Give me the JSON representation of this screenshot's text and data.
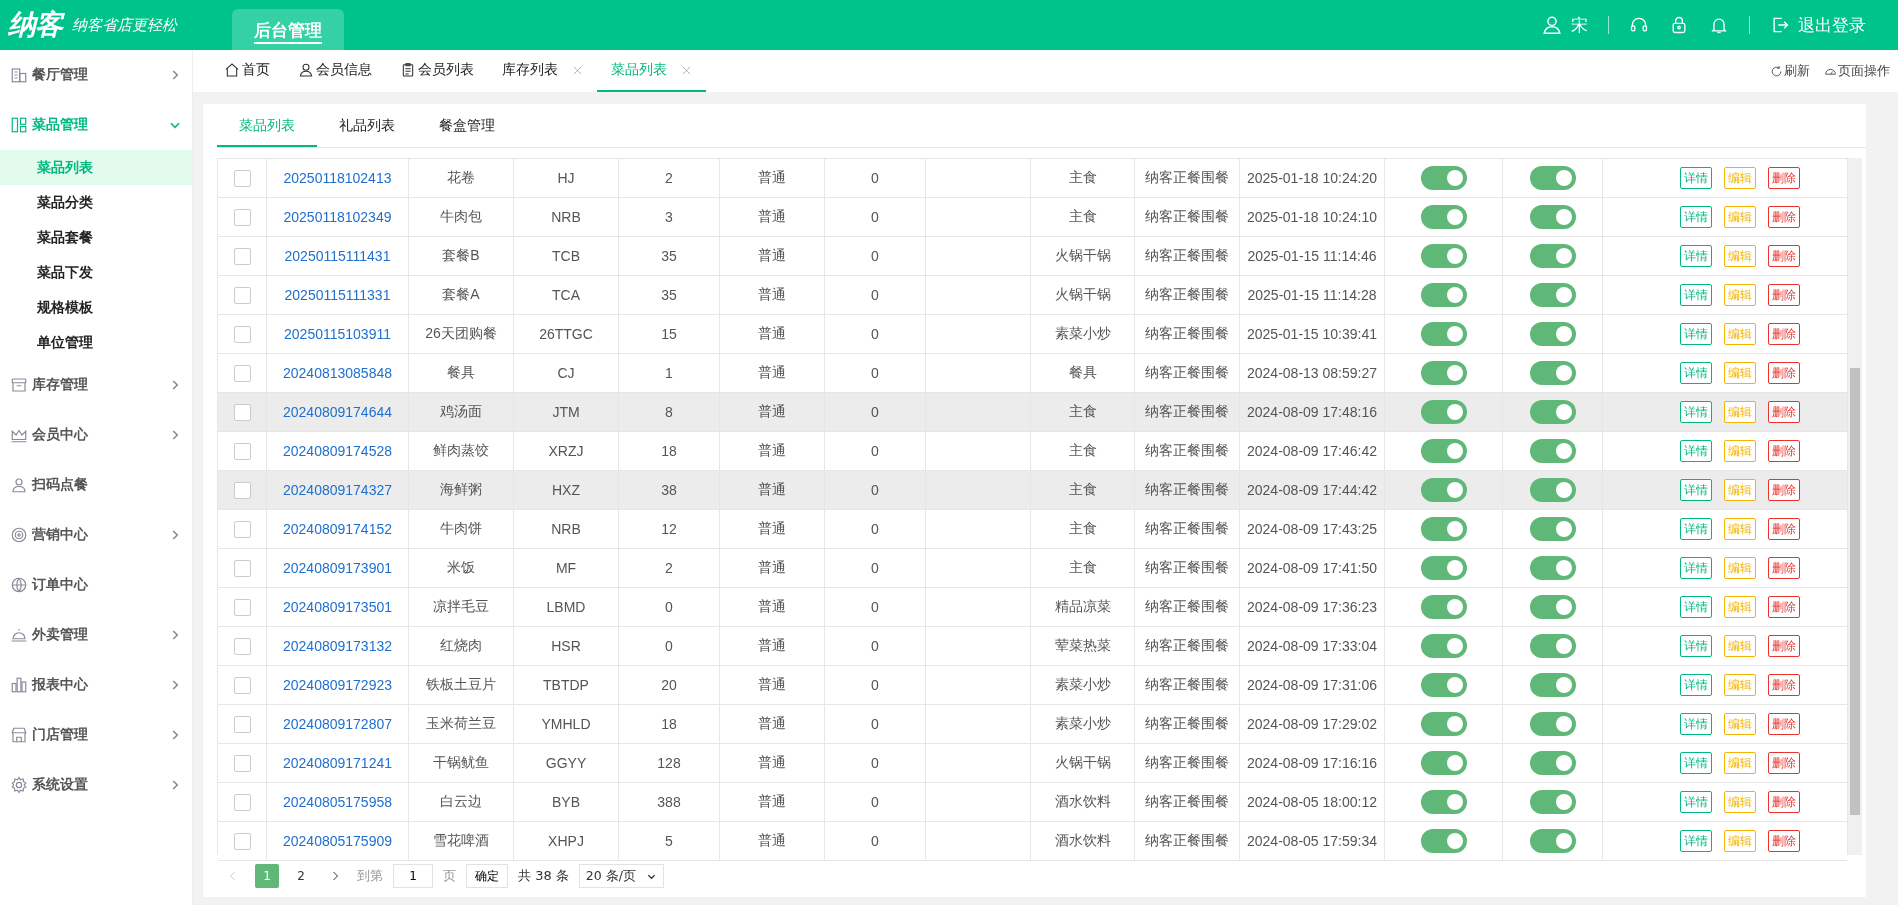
{
  "header": {
    "logo": "纳客",
    "slogan": "纳客省店更轻松",
    "nav_tabs": [
      {
        "label": "后台管理",
        "selected": true
      }
    ],
    "user": "宋",
    "logout": "退出登录"
  },
  "sidebar": {
    "items": [
      {
        "label": "餐厅管理",
        "kind": "group",
        "expanded": false
      },
      {
        "label": "菜品管理",
        "kind": "group",
        "expanded": true,
        "children": [
          {
            "label": "菜品列表",
            "selected": true
          },
          {
            "label": "菜品分类",
            "selected": false
          },
          {
            "label": "菜品套餐",
            "selected": false
          },
          {
            "label": "菜品下发",
            "selected": false
          },
          {
            "label": "规格模板",
            "selected": false
          },
          {
            "label": "单位管理",
            "selected": false
          }
        ]
      },
      {
        "label": "库存管理",
        "kind": "group",
        "expanded": false
      },
      {
        "label": "会员中心",
        "kind": "group",
        "expanded": false
      },
      {
        "label": "扫码点餐",
        "kind": "link"
      },
      {
        "label": "营销中心",
        "kind": "group",
        "expanded": false
      },
      {
        "label": "订单中心",
        "kind": "link"
      },
      {
        "label": "外卖管理",
        "kind": "group",
        "expanded": false
      },
      {
        "label": "报表中心",
        "kind": "group",
        "expanded": false
      },
      {
        "label": "门店管理",
        "kind": "group",
        "expanded": false
      },
      {
        "label": "系统设置",
        "kind": "group",
        "expanded": false
      }
    ]
  },
  "page_tabs": {
    "tabs": [
      {
        "label": "首页",
        "closable": false,
        "selected": false
      },
      {
        "label": "会员信息",
        "closable": false,
        "selected": false
      },
      {
        "label": "会员列表",
        "closable": false,
        "selected": false
      },
      {
        "label": "库存列表",
        "closable": true,
        "selected": false
      },
      {
        "label": "菜品列表",
        "closable": true,
        "selected": true
      }
    ],
    "actions": [
      "刷新",
      "页面操作"
    ]
  },
  "sub_tabs": [
    {
      "label": "菜品列表",
      "selected": true
    },
    {
      "label": "礼品列表",
      "selected": false
    },
    {
      "label": "餐盒管理",
      "selected": false
    }
  ],
  "table": {
    "rows": [
      {
        "checked": false,
        "highlighted": false,
        "cells": [
          "20250118102413",
          "花卷",
          "HJ",
          "2",
          "普通",
          "0",
          "主食",
          "纳客正餐围餐",
          "2025-01-18 10:24:20"
        ],
        "switch_1": true,
        "switch_2": true,
        "actions": [
          {
            "kind": "detail",
            "label": "详情"
          },
          {
            "kind": "edit",
            "label": "编辑"
          },
          {
            "kind": "delete",
            "label": "删除"
          }
        ]
      },
      {
        "checked": false,
        "highlighted": false,
        "cells": [
          "20250118102349",
          "牛肉包",
          "NRB",
          "3",
          "普通",
          "0",
          "主食",
          "纳客正餐围餐",
          "2025-01-18 10:24:10"
        ],
        "switch_1": true,
        "switch_2": true,
        "actions": [
          {
            "kind": "detail",
            "label": "详情"
          },
          {
            "kind": "edit",
            "label": "编辑"
          },
          {
            "kind": "delete",
            "label": "删除"
          }
        ]
      },
      {
        "checked": false,
        "highlighted": false,
        "cells": [
          "20250115111431",
          "套餐B",
          "TCB",
          "35",
          "普通",
          "0",
          "火锅干锅",
          "纳客正餐围餐",
          "2025-01-15 11:14:46"
        ],
        "switch_1": true,
        "switch_2": true,
        "actions": [
          {
            "kind": "detail",
            "label": "详情"
          },
          {
            "kind": "edit",
            "label": "编辑"
          },
          {
            "kind": "delete",
            "label": "删除"
          }
        ]
      },
      {
        "checked": false,
        "highlighted": false,
        "cells": [
          "20250115111331",
          "套餐A",
          "TCA",
          "35",
          "普通",
          "0",
          "火锅干锅",
          "纳客正餐围餐",
          "2025-01-15 11:14:28"
        ],
        "switch_1": true,
        "switch_2": true,
        "actions": [
          {
            "kind": "detail",
            "label": "详情"
          },
          {
            "kind": "edit",
            "label": "编辑"
          },
          {
            "kind": "delete",
            "label": "删除"
          }
        ]
      },
      {
        "checked": false,
        "highlighted": false,
        "cells": [
          "20250115103911",
          "26天团购餐",
          "26TTGC",
          "15",
          "普通",
          "0",
          "素菜小炒",
          "纳客正餐围餐",
          "2025-01-15 10:39:41"
        ],
        "switch_1": true,
        "switch_2": true,
        "actions": [
          {
            "kind": "detail",
            "label": "详情"
          },
          {
            "kind": "edit",
            "label": "编辑"
          },
          {
            "kind": "delete",
            "label": "删除"
          }
        ]
      },
      {
        "checked": false,
        "highlighted": false,
        "cells": [
          "20240813085848",
          "餐具",
          "CJ",
          "1",
          "普通",
          "0",
          "餐具",
          "纳客正餐围餐",
          "2024-08-13 08:59:27"
        ],
        "switch_1": true,
        "switch_2": true,
        "actions": [
          {
            "kind": "detail",
            "label": "详情"
          },
          {
            "kind": "edit",
            "label": "编辑"
          },
          {
            "kind": "delete",
            "label": "删除"
          }
        ]
      },
      {
        "checked": false,
        "highlighted": true,
        "cells": [
          "20240809174644",
          "鸡汤面",
          "JTM",
          "8",
          "普通",
          "0",
          "主食",
          "纳客正餐围餐",
          "2024-08-09 17:48:16"
        ],
        "switch_1": true,
        "switch_2": true,
        "actions": [
          {
            "kind": "detail",
            "label": "详情"
          },
          {
            "kind": "edit",
            "label": "编辑"
          },
          {
            "kind": "delete",
            "label": "删除"
          }
        ]
      },
      {
        "checked": false,
        "highlighted": false,
        "cells": [
          "20240809174528",
          "鲜肉蒸饺",
          "XRZJ",
          "18",
          "普通",
          "0",
          "主食",
          "纳客正餐围餐",
          "2024-08-09 17:46:42"
        ],
        "switch_1": true,
        "switch_2": true,
        "actions": [
          {
            "kind": "detail",
            "label": "详情"
          },
          {
            "kind": "edit",
            "label": "编辑"
          },
          {
            "kind": "delete",
            "label": "删除"
          }
        ]
      },
      {
        "checked": false,
        "highlighted": true,
        "cells": [
          "20240809174327",
          "海鲜粥",
          "HXZ",
          "38",
          "普通",
          "0",
          "主食",
          "纳客正餐围餐",
          "2024-08-09 17:44:42"
        ],
        "switch_1": true,
        "switch_2": true,
        "actions": [
          {
            "kind": "detail",
            "label": "详情"
          },
          {
            "kind": "edit",
            "label": "编辑"
          },
          {
            "kind": "delete",
            "label": "删除"
          }
        ]
      },
      {
        "checked": false,
        "highlighted": false,
        "cells": [
          "20240809174152",
          "牛肉饼",
          "NRB",
          "12",
          "普通",
          "0",
          "主食",
          "纳客正餐围餐",
          "2024-08-09 17:43:25"
        ],
        "switch_1": true,
        "switch_2": true,
        "actions": [
          {
            "kind": "detail",
            "label": "详情"
          },
          {
            "kind": "edit",
            "label": "编辑"
          },
          {
            "kind": "delete",
            "label": "删除"
          }
        ]
      },
      {
        "checked": false,
        "highlighted": false,
        "cells": [
          "20240809173901",
          "米饭",
          "MF",
          "2",
          "普通",
          "0",
          "主食",
          "纳客正餐围餐",
          "2024-08-09 17:41:50"
        ],
        "switch_1": true,
        "switch_2": true,
        "actions": [
          {
            "kind": "detail",
            "label": "详情"
          },
          {
            "kind": "edit",
            "label": "编辑"
          },
          {
            "kind": "delete",
            "label": "删除"
          }
        ]
      },
      {
        "checked": false,
        "highlighted": false,
        "cells": [
          "20240809173501",
          "凉拌毛豆",
          "LBMD",
          "0",
          "普通",
          "0",
          "精品凉菜",
          "纳客正餐围餐",
          "2024-08-09 17:36:23"
        ],
        "switch_1": true,
        "switch_2": true,
        "actions": [
          {
            "kind": "detail",
            "label": "详情"
          },
          {
            "kind": "edit",
            "label": "编辑"
          },
          {
            "kind": "delete",
            "label": "删除"
          }
        ]
      },
      {
        "checked": false,
        "highlighted": false,
        "cells": [
          "20240809173132",
          "红烧肉",
          "HSR",
          "0",
          "普通",
          "0",
          "荤菜热菜",
          "纳客正餐围餐",
          "2024-08-09 17:33:04"
        ],
        "switch_1": true,
        "switch_2": true,
        "actions": [
          {
            "kind": "detail",
            "label": "详情"
          },
          {
            "kind": "edit",
            "label": "编辑"
          },
          {
            "kind": "delete",
            "label": "删除"
          }
        ]
      },
      {
        "checked": false,
        "highlighted": false,
        "cells": [
          "20240809172923",
          "铁板土豆片",
          "TBTDP",
          "20",
          "普通",
          "0",
          "素菜小炒",
          "纳客正餐围餐",
          "2024-08-09 17:31:06"
        ],
        "switch_1": true,
        "switch_2": true,
        "actions": [
          {
            "kind": "detail",
            "label": "详情"
          },
          {
            "kind": "edit",
            "label": "编辑"
          },
          {
            "kind": "delete",
            "label": "删除"
          }
        ]
      },
      {
        "checked": false,
        "highlighted": false,
        "cells": [
          "20240809172807",
          "玉米荷兰豆",
          "YMHLD",
          "18",
          "普通",
          "0",
          "素菜小炒",
          "纳客正餐围餐",
          "2024-08-09 17:29:02"
        ],
        "switch_1": true,
        "switch_2": true,
        "actions": [
          {
            "kind": "detail",
            "label": "详情"
          },
          {
            "kind": "edit",
            "label": "编辑"
          },
          {
            "kind": "delete",
            "label": "删除"
          }
        ]
      },
      {
        "checked": false,
        "highlighted": false,
        "cells": [
          "20240809171241",
          "干锅鱿鱼",
          "GGYY",
          "128",
          "普通",
          "0",
          "火锅干锅",
          "纳客正餐围餐",
          "2024-08-09 17:16:16"
        ],
        "switch_1": true,
        "switch_2": true,
        "actions": [
          {
            "kind": "detail",
            "label": "详情"
          },
          {
            "kind": "edit",
            "label": "编辑"
          },
          {
            "kind": "delete",
            "label": "删除"
          }
        ]
      },
      {
        "checked": false,
        "highlighted": false,
        "cells": [
          "20240805175958",
          "白云边",
          "BYB",
          "388",
          "普通",
          "0",
          "酒水饮料",
          "纳客正餐围餐",
          "2024-08-05 18:00:12"
        ],
        "switch_1": true,
        "switch_2": true,
        "actions": [
          {
            "kind": "detail",
            "label": "详情"
          },
          {
            "kind": "edit",
            "label": "编辑"
          },
          {
            "kind": "delete",
            "label": "删除"
          }
        ]
      },
      {
        "checked": false,
        "highlighted": false,
        "cells": [
          "20240805175909",
          "雪花啤酒",
          "XHPJ",
          "5",
          "普通",
          "0",
          "酒水饮料",
          "纳客正餐围餐",
          "2024-08-05 17:59:34"
        ],
        "switch_1": true,
        "switch_2": true,
        "actions": [
          {
            "kind": "detail",
            "label": "详情"
          },
          {
            "kind": "edit",
            "label": "编辑"
          },
          {
            "kind": "delete",
            "label": "删除"
          }
        ]
      }
    ]
  },
  "pagination": {
    "prev_disabled": true,
    "pages": [
      {
        "label": "1",
        "selected": true
      },
      {
        "label": "2",
        "selected": false
      }
    ],
    "goto_label": "到第",
    "goto_value": "1",
    "page_unit": "页",
    "confirm": "确定",
    "total": "共 38 条",
    "page_size": "20 条/页"
  }
}
